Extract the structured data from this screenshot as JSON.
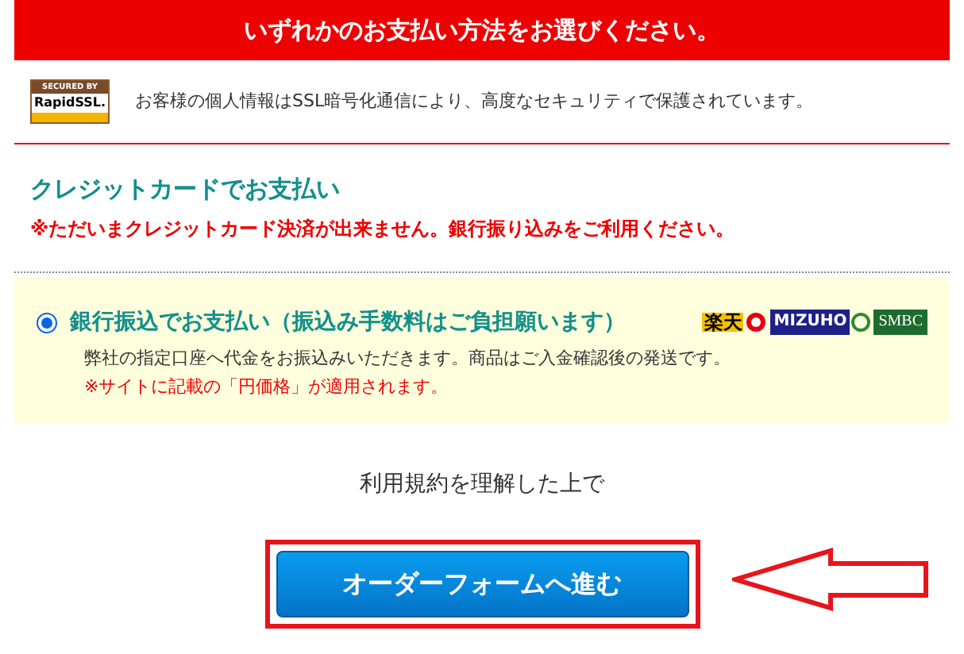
{
  "header": {
    "title": "いずれかのお支払い方法をお選びください。"
  },
  "ssl": {
    "badge_top": "SECURED BY",
    "badge_brand": "RapidSSL.",
    "message": "お客様の個人情報はSSL暗号化通信により、高度なセキュリティで保護されています。"
  },
  "credit_card": {
    "title": "クレジットカードでお支払い",
    "notice": "※ただいまクレジットカード決済が出来ません。銀行振り込みをご利用ください。"
  },
  "bank_transfer": {
    "selected": true,
    "title": "銀行振込でお支払い（振込み手数料はご負担願います）",
    "description": "弊社の指定口座へ代金をお振込みいただきます。商品はご入金確認後の発送です。",
    "note": "※サイトに記載の「円価格」が適用されます。",
    "banks": [
      {
        "kind": "rakuten",
        "label": "楽天"
      },
      {
        "kind": "mizuho",
        "label": "MIZUHO"
      },
      {
        "kind": "smbc",
        "label": "SMBC"
      }
    ]
  },
  "terms": "利用規約を理解した上で",
  "submit": {
    "label": "オーダーフォームへ進む",
    "highlighted": true
  }
}
